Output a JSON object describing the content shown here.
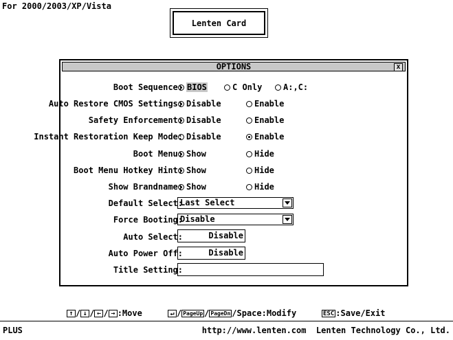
{
  "header": {
    "os_text": "For 2000/2003/XP/Vista",
    "card_title": "Lenten Card"
  },
  "dialog": {
    "title": "OPTIONS",
    "close_label": "x",
    "boot_sequence": {
      "label": "Boot Sequence:",
      "options": [
        "BIOS",
        "C Only",
        "A:,C:"
      ],
      "selected": "BIOS"
    },
    "auto_restore": {
      "label": "Auto Restore CMOS Settings:",
      "options": [
        "Disable",
        "Enable"
      ],
      "selected": "Disable"
    },
    "safety": {
      "label": "Safety Enforcement:",
      "options": [
        "Disable",
        "Enable"
      ],
      "selected": "Disable"
    },
    "instant_restore": {
      "label": "Instant Restoration Keep Mode:",
      "options": [
        "Disable",
        "Enable"
      ],
      "selected": "Enable"
    },
    "boot_menu": {
      "label": "Boot Menu:",
      "options": [
        "Show",
        "Hide"
      ],
      "selected": "Show"
    },
    "hotkey_hint": {
      "label": "Boot Menu Hotkey Hint:",
      "options": [
        "Show",
        "Hide"
      ],
      "selected": "Show"
    },
    "brandname": {
      "label": "Show Brandname:",
      "options": [
        "Show",
        "Hide"
      ],
      "selected": "Show"
    },
    "default_select": {
      "label": "Default Select:",
      "value": "Last Select"
    },
    "force_booting": {
      "label": "Force Booting:",
      "value": "Disable"
    },
    "auto_select": {
      "label": "Auto Select:",
      "value": "Disable"
    },
    "auto_power_off": {
      "label": "Auto Power Off:",
      "value": "Disable"
    },
    "title_setting": {
      "label": "Title Setting:",
      "value": ""
    }
  },
  "footer": {
    "move_label": ":Move",
    "pageup_key": "PageUp",
    "pagedown_key": "PageDn",
    "modify_label": "/Space:Modify",
    "esc_key": "ESC",
    "save_exit_label": ":Save/Exit"
  },
  "status": {
    "left": "PLUS",
    "right": "http://www.lenten.com  Lenten Technology Co., Ltd."
  }
}
